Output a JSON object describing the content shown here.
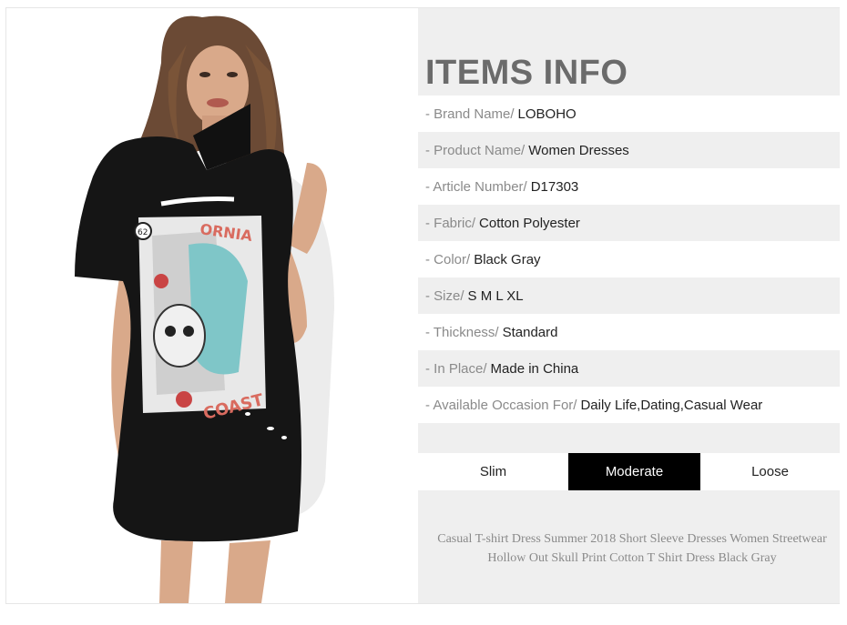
{
  "info": {
    "title": "ITEMS INFO",
    "rows": [
      {
        "key": "- Brand Name/",
        "value": "LOBOHO"
      },
      {
        "key": "- Product Name/",
        "value": "Women Dresses"
      },
      {
        "key": "- Article Number/",
        "value": "D17303"
      },
      {
        "key": "- Fabric/",
        "value": "Cotton Polyester"
      },
      {
        "key": "- Color/",
        "value": "Black Gray"
      },
      {
        "key": "- Size/",
        "value": "S M L XL"
      },
      {
        "key": "- Thickness/",
        "value": "Standard"
      },
      {
        "key": "- In Place/",
        "value": "Made in China"
      },
      {
        "key": "- Available Occasion For/",
        "value": "Daily Life,Dating,Casual Wear"
      }
    ],
    "fit": [
      "Slim",
      "Moderate",
      "Loose"
    ],
    "fit_selected": "Moderate",
    "description": "Casual T-shirt Dress Summer 2018 Short Sleeve Dresses Women Streetwear Hollow Out Skull Print Cotton T Shirt Dress Black Gray"
  },
  "photo": {
    "print_text_top": "ORNIA",
    "print_text_bottom": "COAST",
    "print_badge": "62"
  }
}
